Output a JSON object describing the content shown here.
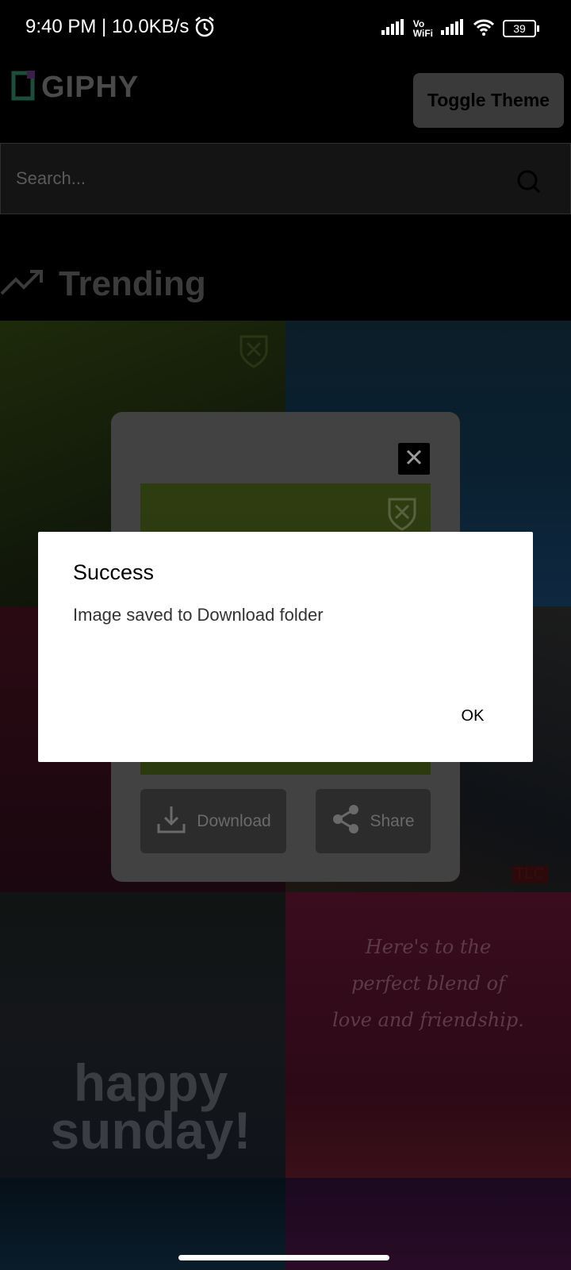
{
  "status_bar": {
    "time": "9:40 PM | 10.0KB/s",
    "battery": "39",
    "icons": [
      "alarm-icon",
      "signal-icon",
      "vowifi-icon",
      "signal-icon",
      "wifi-icon",
      "battery-icon"
    ],
    "vowifi_top": "Vo",
    "vowifi_bottom": "WiFi"
  },
  "header": {
    "logo_text": "GIPHY",
    "toggle_label": "Toggle Theme"
  },
  "search": {
    "placeholder": "Search..."
  },
  "trending": {
    "label": "Trending"
  },
  "grid": {
    "tile_5_text_line1": "happy",
    "tile_5_text_line2": "sunday!",
    "tile_4_badge": "TLC",
    "tile_6_text_line1": "Here's to the",
    "tile_6_text_line2": "perfect blend of",
    "tile_6_text_line3": "love and friendship."
  },
  "product_modal": {
    "download_label": "Download",
    "share_label": "Share"
  },
  "dialog": {
    "title": "Success",
    "message": "Image saved to Download folder",
    "ok_label": "OK"
  },
  "colors": {
    "dialog_bg": "#ffffff",
    "modal_bg": "#424242",
    "scrim": "#000000"
  }
}
